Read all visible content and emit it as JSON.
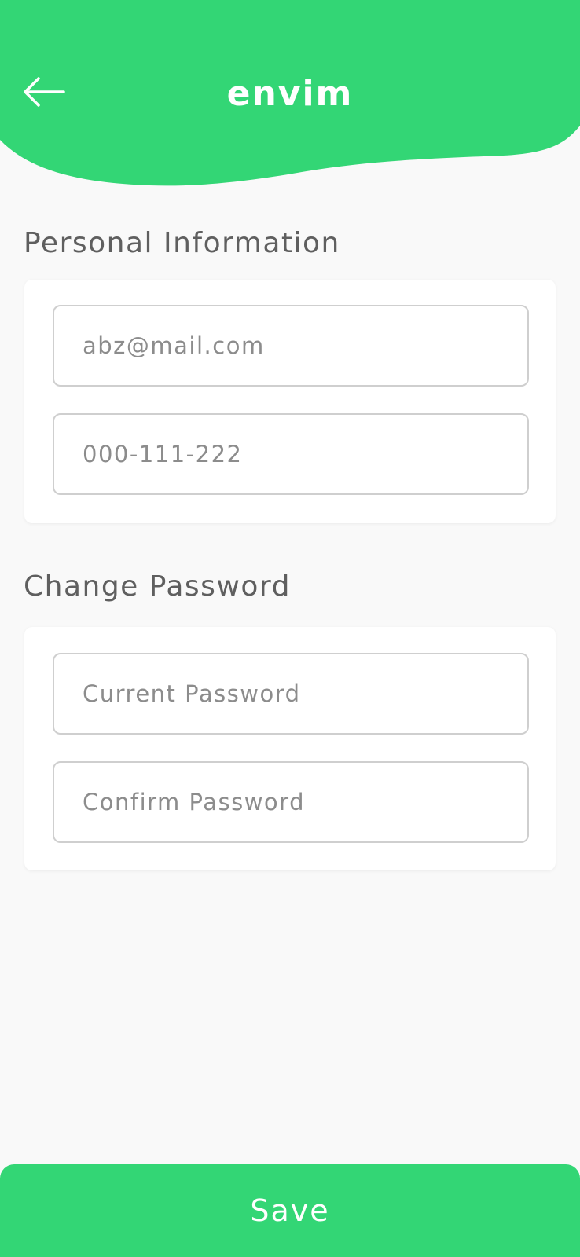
{
  "colors": {
    "brand": "#33d675",
    "background": "#f9f9f9",
    "text_secondary": "#5f5f5f",
    "placeholder": "#8c8c8c"
  },
  "header": {
    "back_icon": "arrow-left-icon",
    "title": "envim"
  },
  "personal": {
    "title": "Personal Information",
    "email_placeholder": "abz@mail.com",
    "phone_placeholder": "000-111-222"
  },
  "password": {
    "title": "Change Password",
    "current_placeholder": "Current Password",
    "confirm_placeholder": "Confirm Password"
  },
  "actions": {
    "save_label": "Save"
  }
}
